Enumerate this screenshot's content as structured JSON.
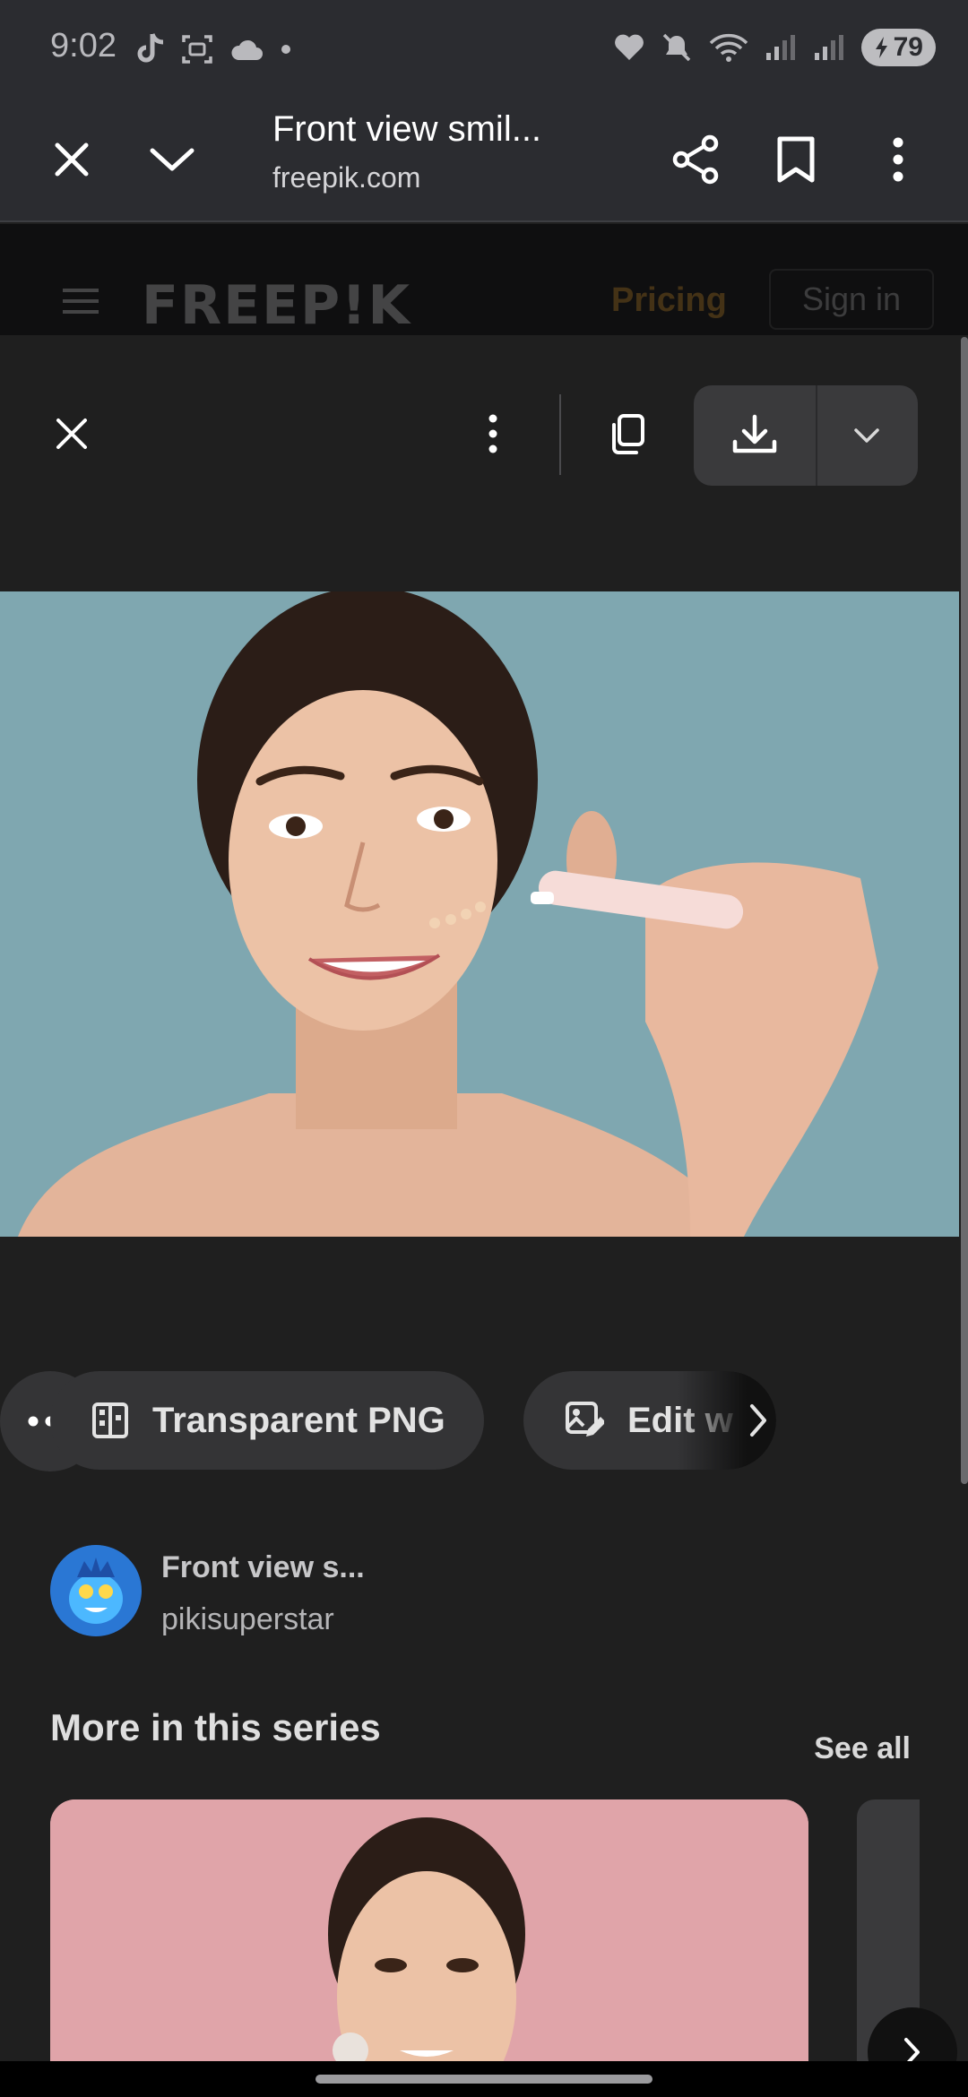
{
  "status_bar": {
    "time": "9:02",
    "battery": "79"
  },
  "toolbar": {
    "title": "Front view smil...",
    "domain": "freepik.com"
  },
  "site_header": {
    "logo": "FREEP!K",
    "pricing": "Pricing",
    "sign_in": "Sign in"
  },
  "actions": {
    "transparent_png": "Transparent PNG",
    "edit": "Edit w"
  },
  "author": {
    "title": "Front view s...",
    "name": "pikisuperstar"
  },
  "series": {
    "title": "More in this series",
    "see_all": "See all"
  },
  "colors": {
    "background": "#1f1f1f",
    "toolbar": "#2b2c30",
    "accent_pricing": "#ffb02e",
    "photo_bg": "#7ea7b0",
    "series_card_bg": "#dea1a6"
  }
}
